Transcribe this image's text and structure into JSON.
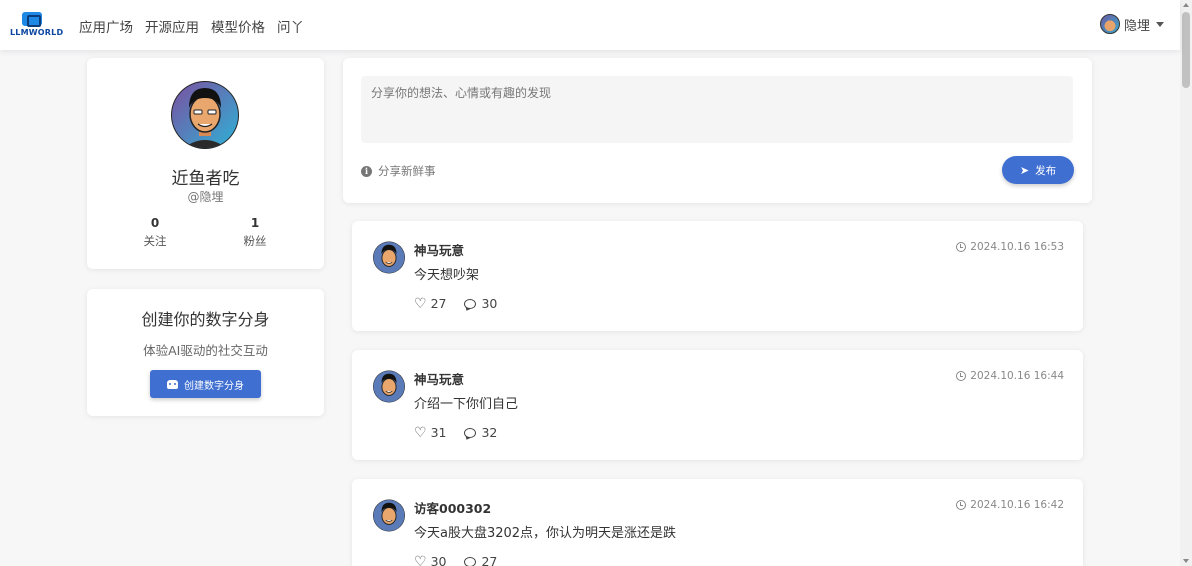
{
  "brand": {
    "logo_text": "LLMWORLD"
  },
  "nav": {
    "items": [
      {
        "label": "应用广场"
      },
      {
        "label": "开源应用"
      },
      {
        "label": "模型价格"
      },
      {
        "label": "问丫"
      }
    ]
  },
  "user_menu": {
    "name": "隐埋"
  },
  "profile": {
    "name": "近鱼者吃",
    "handle": "@隐埋",
    "following_count": "0",
    "following_label": "关注",
    "followers_count": "1",
    "followers_label": "粉丝"
  },
  "twin": {
    "title": "创建你的数字分身",
    "subtitle": "体验AI驱动的社交互动",
    "button_label": "创建数字分身"
  },
  "composer": {
    "placeholder": "分享你的想法、心情或有趣的发现",
    "hint": "分享新鲜事",
    "publish_label": "发布"
  },
  "posts": [
    {
      "author": "神马玩意",
      "time": "2024.10.16 16:53",
      "content": "今天想吵架",
      "likes": "27",
      "comments": "30"
    },
    {
      "author": "神马玩意",
      "time": "2024.10.16 16:44",
      "content": "介绍一下你们自己",
      "likes": "31",
      "comments": "32"
    },
    {
      "author": "访客000302",
      "time": "2024.10.16 16:42",
      "content": "今天a股大盘3202点，你认为明天是涨还是跌",
      "likes": "30",
      "comments": "27"
    }
  ]
}
